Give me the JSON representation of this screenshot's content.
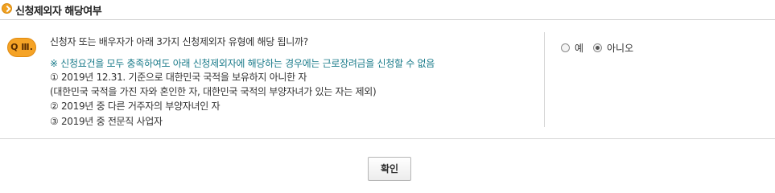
{
  "section": {
    "title": "신청제외자 해당여부"
  },
  "question": {
    "badge": "Q Ⅲ.",
    "text": "신청자 또는 배우자가 아래 3가지 신청제외자 유형에 해당 됩니까?",
    "note": "※ 신청요건을 모두 충족하여도 아래 신청제외자에 해당하는 경우에는 근로장려금을 신청할 수 없음",
    "items": [
      "① 2019년 12.31. 기준으로 대한민국 국적을 보유하지 아니한 자",
      "(대한민국 국적을 가진 자와 혼인한 자, 대한민국 국적의 부양자녀가 있는 자는 제외)",
      "② 2019년 중 다른 거주자의 부양자녀인 자",
      "③ 2019년 중 전문직 사업자"
    ]
  },
  "options": {
    "yes_label": "예",
    "no_label": "아니오",
    "selected": "no"
  },
  "buttons": {
    "confirm_label": "확인"
  },
  "colors": {
    "accent": "#f5a326",
    "note_text": "#1a7b8a"
  },
  "icons": {
    "section_bullet": "orange-circle-chevron-icon"
  }
}
